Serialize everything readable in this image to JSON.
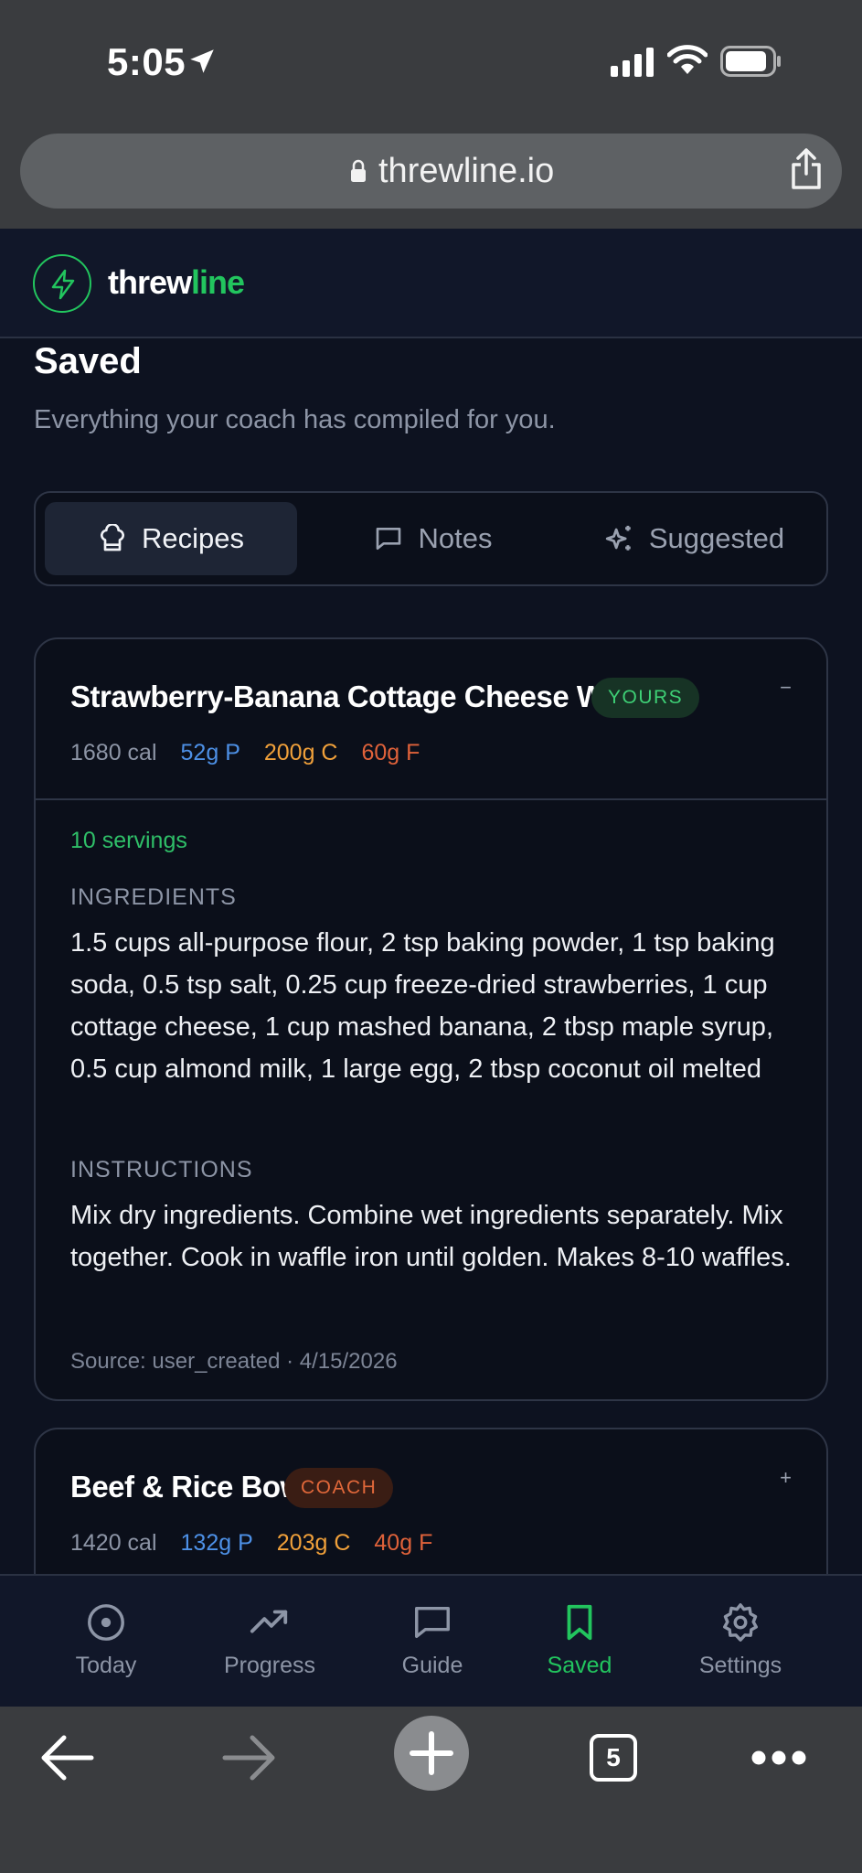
{
  "status_bar": {
    "time": "5:05"
  },
  "browser": {
    "url": "threwline.io",
    "tab_count": "5"
  },
  "app": {
    "brand_part1": "threw",
    "brand_part2": "line"
  },
  "page": {
    "title": "Saved",
    "subtitle": "Everything your coach has compiled for you."
  },
  "tabs": [
    {
      "label": "Recipes",
      "icon": "chef-hat-icon",
      "active": true
    },
    {
      "label": "Notes",
      "icon": "chat-bubble-icon",
      "active": false
    },
    {
      "label": "Suggested",
      "icon": "sparkles-icon",
      "active": false
    }
  ],
  "recipes": [
    {
      "title": "Strawberry-Banana Cottage Cheese Waffles",
      "badge": "YOURS",
      "toggle": "−",
      "cal": "1680 cal",
      "protein": "52g P",
      "carbs": "200g C",
      "fat": "60g F",
      "servings": "10 servings",
      "ingredients_label": "INGREDIENTS",
      "ingredients": "1.5 cups all-purpose flour, 2 tsp baking powder, 1 tsp baking soda, 0.5 tsp salt, 0.25 cup freeze-dried strawberries, 1 cup cottage cheese, 1 cup mashed banana, 2 tbsp maple syrup, 0.5 cup almond milk, 1 large egg, 2 tbsp coconut oil melted",
      "instructions_label": "INSTRUCTIONS",
      "instructions": "Mix dry ingredients. Combine wet ingredients separately. Mix together. Cook in waffle iron until golden. Makes 8-10 waffles.",
      "source": "Source: user_created · 4/15/2026"
    },
    {
      "title": "Beef & Rice Bowl",
      "badge": "COACH",
      "toggle": "+",
      "cal": "1420 cal",
      "protein": "132g P",
      "carbs": "203g C",
      "fat": "40g F"
    }
  ],
  "nav": [
    {
      "label": "Today",
      "icon": "target-icon"
    },
    {
      "label": "Progress",
      "icon": "trend-up-icon"
    },
    {
      "label": "Guide",
      "icon": "chat-bubble-icon"
    },
    {
      "label": "Saved",
      "icon": "bookmark-icon",
      "active": true
    },
    {
      "label": "Settings",
      "icon": "gear-icon"
    }
  ],
  "colors": {
    "accent": "#22c55e",
    "protein": "#4d90e6",
    "carbs": "#f0a03a",
    "fat": "#e0623a",
    "background": "#0d1220"
  }
}
